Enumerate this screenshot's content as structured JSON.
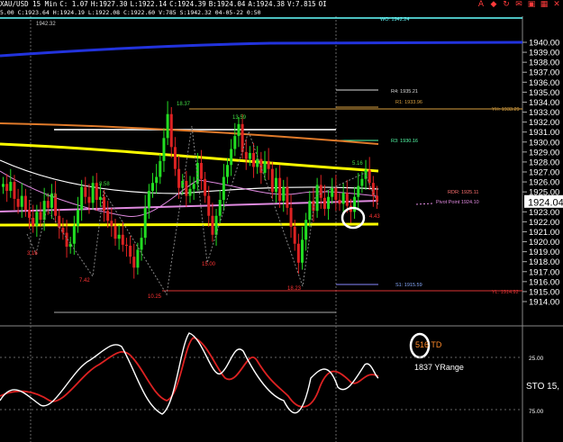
{
  "title": {
    "symbol": "XAU/USD 15 Min",
    "change": "C: 1.07",
    "high": "H:1927.30",
    "low": "L:1922.14",
    "close": "C:1924.39",
    "bid": "B:1924.04",
    "ask": "A:1924.38",
    "volume": "V:7.815",
    "oi": "OI"
  },
  "info_line": "5.00 C:1923.64 H:1924.19 L:1922.08 C:1922.60 V:785 S:1942.32 04-05-22 0:50",
  "window_icons": [
    "a-icon",
    "diamond-icon",
    "refresh-icon",
    "mail-icon",
    "lock-icon",
    "grid-icon",
    "close-icon"
  ],
  "price_axis": {
    "labels": [
      "1940.00",
      "1939.00",
      "1938.00",
      "1937.00",
      "1936.00",
      "1935.00",
      "1934.00",
      "1933.00",
      "1932.00",
      "1931.00",
      "1930.00",
      "1929.00",
      "1928.00",
      "1927.00",
      "1926.00",
      "1925.00",
      "1924.04",
      "1923.00",
      "1922.00",
      "1921.00",
      "1920.00",
      "1919.00",
      "1918.00",
      "1917.00",
      "1916.00",
      "1915.00",
      "1914.00"
    ],
    "current_price": "1924.04"
  },
  "pivot_labels": {
    "wo": "WO: 1942.24",
    "r4": "R4: 1935.21",
    "r1": "R1: 1933.96",
    "yh": "YH: 1933.29",
    "r3": "R3: 1930.16",
    "rdr": "RDR: 1925.11",
    "pivot": "Pivot Point 1924.10",
    "s1": "S1: 1915.59",
    "yl": "YL: 1914.92",
    "prev_level": "1942.32"
  },
  "swing_labels": {
    "s1837": "18.37",
    "s1359": "13.59",
    "s858": "8.58",
    "s482": "4.82",
    "s516": "5.16",
    "s316": "3.16",
    "s742": "7.42",
    "s1025": "10.25",
    "s1500": "15.00",
    "s1823": "18.23",
    "s443": "4.43"
  },
  "annotations": {
    "td_label": "516 TD",
    "yrange_label": "1837 YRange"
  },
  "oscillator": {
    "name": "STO 15,",
    "level_high": "25.00",
    "level_low": "75.00"
  },
  "colors": {
    "background": "#000000",
    "bull_candle": "#22dd22",
    "bear_candle": "#dd2222",
    "yellow_ma": "#ffff00",
    "orange_ma": "#e07a2a",
    "blue_ma": "#2233dd",
    "pink_ma": "#e08ae0",
    "white_ma": "#ffffff",
    "stoch_k": "#ffffff",
    "stoch_d": "#dd2222",
    "swing_green": "#44dd44",
    "swing_red": "#ff3333"
  }
}
